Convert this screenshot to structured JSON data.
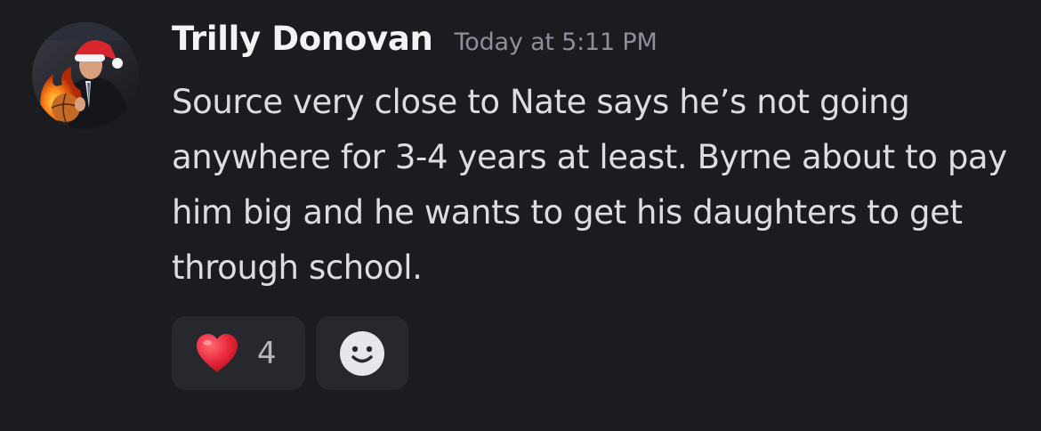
{
  "message": {
    "author": "Trilly Donovan",
    "timestamp": "Today at 5:11 PM",
    "content": "Source very close to Nate says he’s not going anywhere for 3-4 years at least. Byrne about to pay him big and he wants to get his daughters to get through school."
  },
  "avatar": {
    "icon": "user-avatar-santa-hat-flaming-basketball"
  },
  "reactions": [
    {
      "emoji": "heart",
      "count": "4",
      "color": "#e8263a"
    }
  ],
  "add_reaction": {
    "icon": "add-reaction-smiley-icon"
  },
  "colors": {
    "background": "#1b1c20",
    "reaction_background": "#27282e",
    "username": "#f2f3f5",
    "timestamp": "#8d909a",
    "text": "#dcdde1"
  }
}
